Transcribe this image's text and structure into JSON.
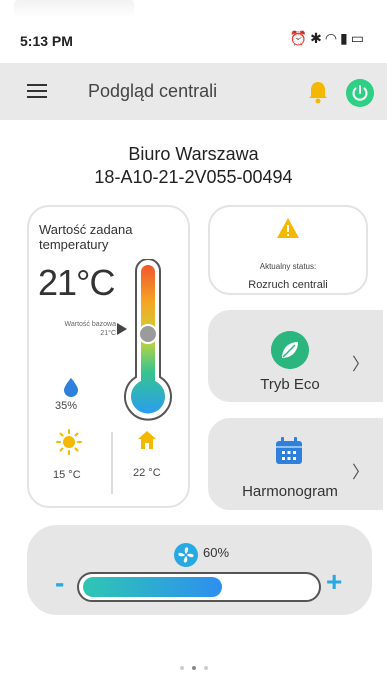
{
  "status_bar": {
    "time": "5:13 PM",
    "icons": [
      "alarm-icon",
      "bluetooth-icon",
      "wifi-icon",
      "signal-icon",
      "battery-icon"
    ]
  },
  "header": {
    "title": "Podgląd centrali",
    "menu_icon": "hamburger-icon",
    "bell_color": "#f5b800",
    "power_color": "#2fcf85"
  },
  "location": {
    "name": "Biuro Warszawa",
    "device_id": "18-A10-21-2V055-00494"
  },
  "temperature": {
    "set_label": "Wartość zadana temperatury",
    "set_value": "21°C",
    "base_label": "Wartość bazowa",
    "base_value": "21°C",
    "humidity": "35%",
    "outside_temp": "15 °C",
    "inside_temp": "22 °C"
  },
  "status": {
    "label": "Aktualny status:",
    "value": "Rozruch centrali",
    "icon": "warning-icon",
    "color": "#f5b800"
  },
  "eco": {
    "label": "Tryb Eco",
    "color": "#2bb57f"
  },
  "schedule": {
    "label": "Harmonogram",
    "color": "#2f7fdc"
  },
  "fan": {
    "value": "60%",
    "level": 0.6,
    "minus": "-",
    "plus": "+",
    "color": "#27a9e1"
  },
  "pager": {
    "pages": 3,
    "active": 1
  }
}
